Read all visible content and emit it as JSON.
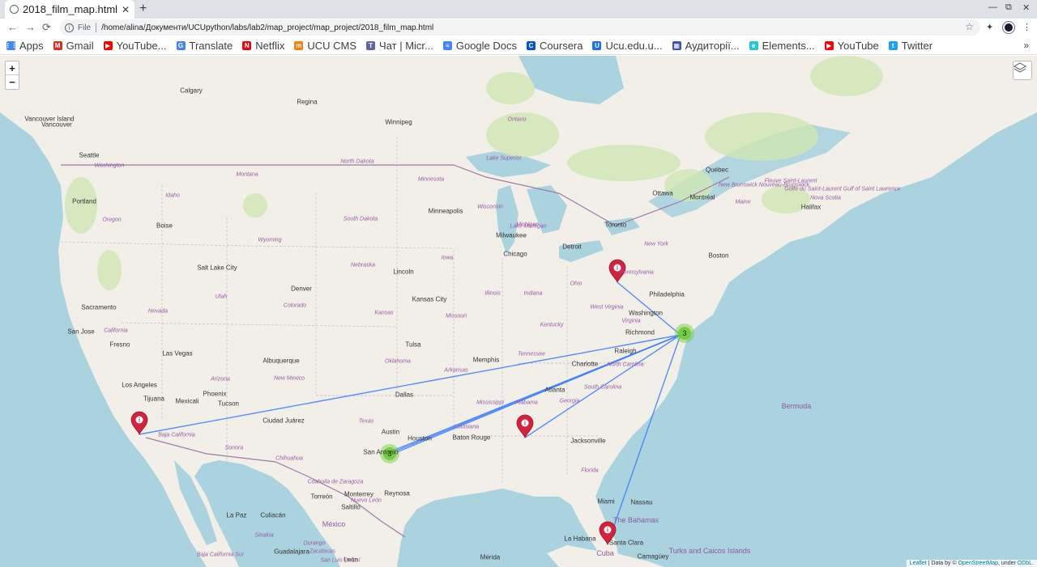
{
  "tab": {
    "title": "2018_film_map.html",
    "close": "✕"
  },
  "newtab": "+",
  "window": {
    "minimize": "—",
    "maximize": "⧉",
    "close": "✕"
  },
  "toolbar": {
    "back": "←",
    "forward": "→",
    "reload": "⟳",
    "file_label": "File",
    "url": "/home/alina/Документи/UCUpython/labs/lab2/map_project/map_project/2018_film_map.html"
  },
  "bookmarks": [
    {
      "label": "Apps",
      "icon": "apps-icon",
      "color": "#4285f4"
    },
    {
      "label": "Gmail",
      "icon": "gmail-icon",
      "color": "#d93025"
    },
    {
      "label": "YouTube...",
      "icon": "youtube-icon",
      "color": "#ff0000"
    },
    {
      "label": "Translate",
      "icon": "translate-icon",
      "color": "#4285f4"
    },
    {
      "label": "Netflix",
      "icon": "netflix-icon",
      "color": "#e50914"
    },
    {
      "label": "UCU CMS",
      "icon": "moodle-icon",
      "color": "#f98012"
    },
    {
      "label": "Чат | Micr...",
      "icon": "teams-icon",
      "color": "#6264a7"
    },
    {
      "label": "Google Docs",
      "icon": "docs-icon",
      "color": "#4285f4"
    },
    {
      "label": "Coursera",
      "icon": "coursera-icon",
      "color": "#0056d2"
    },
    {
      "label": "Ucu.edu.u...",
      "icon": "ucu-icon",
      "color": "#1a73e8"
    },
    {
      "label": "Аудиторії...",
      "icon": "calendar-icon",
      "color": "#3f51b5"
    },
    {
      "label": "Elements...",
      "icon": "elements-icon",
      "color": "#26c6da"
    },
    {
      "label": "YouTube",
      "icon": "youtube-icon",
      "color": "#ff0000"
    },
    {
      "label": "Twitter",
      "icon": "twitter-icon",
      "color": "#1da1f2"
    }
  ],
  "bookmarks_more": "»",
  "map": {
    "zoom_in": "+",
    "zoom_out": "−",
    "attribution": {
      "leaflet": "Leaflet",
      "data": " | Data by © ",
      "osm": "OpenStreetMap",
      "under": ", under ",
      "odbl": "ODbL."
    },
    "cities": [
      {
        "name": "Calgary"
      },
      {
        "name": "Regina"
      },
      {
        "name": "Winnipeg"
      },
      {
        "name": "Vancouver"
      },
      {
        "name": "Vancouver Island"
      },
      {
        "name": "Seattle"
      },
      {
        "name": "Portland"
      },
      {
        "name": "Boise"
      },
      {
        "name": "Salt Lake City"
      },
      {
        "name": "Sacramento"
      },
      {
        "name": "San Jose"
      },
      {
        "name": "Fresno"
      },
      {
        "name": "Las Vegas"
      },
      {
        "name": "Los Angeles"
      },
      {
        "name": "Tijuana"
      },
      {
        "name": "Mexicali"
      },
      {
        "name": "Phoenix"
      },
      {
        "name": "Tucson"
      },
      {
        "name": "Albuquerque"
      },
      {
        "name": "Denver"
      },
      {
        "name": "Ciudad Juárez"
      },
      {
        "name": "Minneapolis"
      },
      {
        "name": "Milwaukee"
      },
      {
        "name": "Chicago"
      },
      {
        "name": "Lincoln"
      },
      {
        "name": "Kansas City"
      },
      {
        "name": "Tulsa"
      },
      {
        "name": "Memphis"
      },
      {
        "name": "Dallas"
      },
      {
        "name": "Austin"
      },
      {
        "name": "Houston"
      },
      {
        "name": "San Antonio"
      },
      {
        "name": "Baton Rouge"
      },
      {
        "name": "Atlanta"
      },
      {
        "name": "Charlotte"
      },
      {
        "name": "Raleigh"
      },
      {
        "name": "Richmond"
      },
      {
        "name": "Washington"
      },
      {
        "name": "Philadelphia"
      },
      {
        "name": "Detroit"
      },
      {
        "name": "Toronto"
      },
      {
        "name": "Ottawa"
      },
      {
        "name": "Montréal"
      },
      {
        "name": "Québec"
      },
      {
        "name": "Boston"
      },
      {
        "name": "Halifax"
      },
      {
        "name": "Jacksonville"
      },
      {
        "name": "Miami"
      },
      {
        "name": "Nassau"
      },
      {
        "name": "Monterrey"
      },
      {
        "name": "Reynosa"
      },
      {
        "name": "Torreón"
      },
      {
        "name": "Saltillo"
      },
      {
        "name": "Culiacán"
      },
      {
        "name": "La Paz"
      },
      {
        "name": "México"
      },
      {
        "name": "Mérida"
      },
      {
        "name": "La Habana"
      },
      {
        "name": "Cuba"
      },
      {
        "name": "Santa Clara"
      },
      {
        "name": "Camagüey"
      },
      {
        "name": "Bermuda"
      },
      {
        "name": "The Bahamas"
      },
      {
        "name": "Turks and Caicos Islands"
      },
      {
        "name": "León"
      },
      {
        "name": "Guadalajara"
      }
    ],
    "states": [
      "Washington",
      "Oregon",
      "Idaho",
      "Montana",
      "Wyoming",
      "Nevada",
      "California",
      "Utah",
      "Arizona",
      "Colorado",
      "New Mexico",
      "North Dakota",
      "South Dakota",
      "Nebraska",
      "Kansas",
      "Oklahoma",
      "Texas",
      "Minnesota",
      "Iowa",
      "Missouri",
      "Arkansas",
      "Louisiana",
      "Wisconsin",
      "Illinois",
      "Michigan",
      "Indiana",
      "Ohio",
      "Kentucky",
      "Tennessee",
      "Mississippi",
      "Alabama",
      "Georgia",
      "Florida",
      "South Carolina",
      "North Carolina",
      "Virginia",
      "West Virginia",
      "Pennsylvania",
      "New York",
      "Maine",
      "Ontario",
      "New Brunswick Nouveau-Brunswick",
      "Nova Scotia",
      "Baja California",
      "Sonora",
      "Chihuahua",
      "Coahuila de Zaragoza",
      "Nuevo León",
      "Sinaloa",
      "Baja California Sur",
      "Durango",
      "Zacatecas",
      "San Luis Potosí",
      "Golfe du Saint-Laurent Gulf of Saint Lawrence",
      "Fleuve Saint-Laurent",
      "Lake Superior",
      "Lake Michigan"
    ],
    "clusters": [
      {
        "count": "3"
      },
      {
        "count": "3"
      }
    ],
    "markers": [
      "Toronto",
      "Los Angeles",
      "Alabama",
      "Miami"
    ],
    "marker_icon": "i",
    "accent_color": "#3b7cff",
    "marker_color": "#d2223e",
    "cluster_color": "#6ecc39"
  }
}
